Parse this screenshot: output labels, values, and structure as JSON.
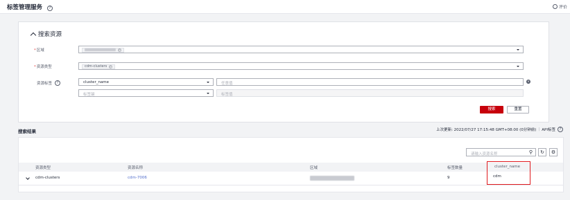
{
  "header": {
    "title": "标签管理服务",
    "help_icon": "?",
    "evaluate_label": "评价"
  },
  "search_section": {
    "title": "搜索资源",
    "region": {
      "label": "区域",
      "required": true,
      "chip_close": "⊗"
    },
    "resource_type": {
      "label": "资源类型",
      "required": true,
      "chip": "cdm-clusters"
    },
    "resource_tag": {
      "label": "资源标签",
      "help_icon": "?",
      "key_value": "cluster_name",
      "value_placeholder": "任意值",
      "key_placeholder": "标签键",
      "value_placeholder2": "标签值"
    },
    "search_button": "搜索",
    "reset_button": "重置"
  },
  "results": {
    "title": "搜索结果",
    "last_update": "上次更新: 2022/07/27 17:15:48 GMT+08:00 (0分钟前)",
    "separator": "|",
    "api_tag_link": "API标签",
    "search_placeholder": "请输入资源名称",
    "columns": [
      "资源类型",
      "资源名称",
      "区域",
      "标签数量",
      "cluster_name"
    ],
    "rows": [
      {
        "type": "cdm-clusters",
        "name": "cdm-7006",
        "tag_count": "9",
        "cluster_name": "cdm"
      }
    ]
  },
  "colors": {
    "primary": "#c7000b",
    "link": "#526ecc",
    "highlight_border": "#e0191d"
  }
}
